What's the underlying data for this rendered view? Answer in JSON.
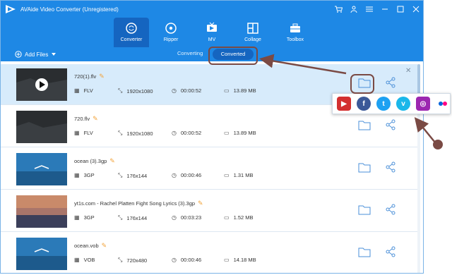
{
  "app": {
    "title": "AVAide Video Converter (Unregistered)"
  },
  "nav": {
    "tabs": [
      {
        "label": "Converter",
        "icon": "converter-icon"
      },
      {
        "label": "Ripper",
        "icon": "disc-icon"
      },
      {
        "label": "MV",
        "icon": "tv-icon"
      },
      {
        "label": "Collage",
        "icon": "collage-icon"
      },
      {
        "label": "Toolbox",
        "icon": "toolbox-icon"
      }
    ]
  },
  "toolbar": {
    "add_files": "Add Files",
    "converting": "Converting",
    "converted": "Converted"
  },
  "files": [
    {
      "name": "720(1).flv",
      "format": "FLV",
      "resolution": "1920x1080",
      "duration": "00:00:52",
      "size": "13.89 MB"
    },
    {
      "name": "720.flv",
      "format": "FLV",
      "resolution": "1920x1080",
      "duration": "00:00:52",
      "size": "13.89 MB"
    },
    {
      "name": "ocean (3).3gp",
      "format": "3GP",
      "resolution": "176x144",
      "duration": "00:00:46",
      "size": "1.31 MB"
    },
    {
      "name": "yt1s.com - Rachel Platten  Fight Song Lyrics (3).3gp",
      "format": "3GP",
      "resolution": "176x144",
      "duration": "00:03:23",
      "size": "1.52 MB"
    },
    {
      "name": "ocean.vob",
      "format": "VOB",
      "resolution": "720x480",
      "duration": "00:00:46",
      "size": "14.18 MB"
    }
  ],
  "social": {
    "items": [
      {
        "name": "youtube",
        "color": "#d32f2f"
      },
      {
        "name": "facebook",
        "color": "#3b5998"
      },
      {
        "name": "twitter",
        "color": "#1da1f2"
      },
      {
        "name": "vimeo",
        "color": "#1ab7ea"
      },
      {
        "name": "instagram",
        "color": "#9c27b0"
      },
      {
        "name": "flickr",
        "color": "#ffffff"
      }
    ]
  },
  "colors": {
    "accent": "#1e88e5",
    "accent_dark": "#1565c0",
    "annotation": "#7a4a44",
    "selected_row": "#d7ebfb"
  }
}
